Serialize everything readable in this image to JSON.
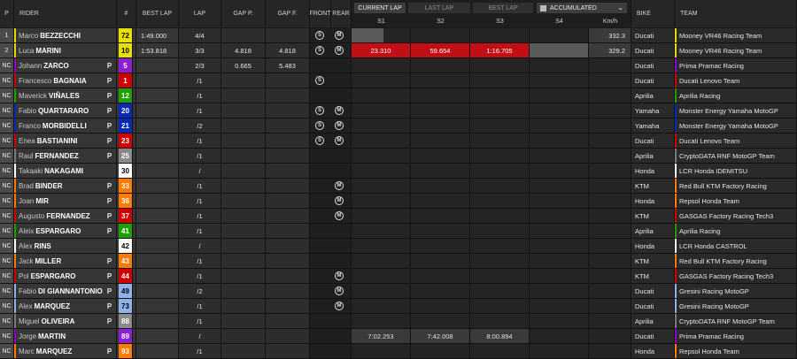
{
  "header": {
    "pos": "P",
    "rider": "RIDER",
    "num": "#",
    "best_lap": "BEST LAP",
    "lap": "LAP",
    "gap_p": "GAP P.",
    "gap_f": "GAP F.",
    "front": "FRONT",
    "rear": "REAR",
    "bike": "BIKE",
    "team": "TEAM",
    "kmh": "Km/h",
    "s1": "S1",
    "s2": "S2",
    "s3": "S3",
    "s4": "S4"
  },
  "modes": {
    "current": "CURRENT LAP",
    "last": "LAST LAP",
    "best": "BEST LAP",
    "selected": "ACCUMULATED"
  },
  "colors": {
    "ducati_team": "#e3d800",
    "pramac": "#8c00c8",
    "lenovo": "#d40000",
    "aprilia": "#1ea000",
    "yamaha": "#0a2ab4",
    "honda": "#ffffff",
    "ktm": "#ff7a00",
    "gresini": "#8fb3e8",
    "gasgas": "#d40000",
    "sector_red": "#c20f16"
  },
  "riders": [
    {
      "pos": "1",
      "first": "Marco",
      "last": "BEZZECCHI",
      "pit": "",
      "num": "72",
      "numbg": "#e8e000",
      "numfg": "#000",
      "best": "1:49.000",
      "lap": "4/4",
      "gapp": "",
      "gapf": "",
      "front": "S",
      "rear": "M",
      "s1": "",
      "s2": "",
      "s3": "",
      "s4": "",
      "kmh": "332.3",
      "bike": "Ducati",
      "team": "Mooney VR46 Racing Team",
      "accent": "#e3d800",
      "s1type": "partial",
      "kmhbar": true
    },
    {
      "pos": "2",
      "first": "Luca",
      "last": "MARINI",
      "pit": "",
      "num": "10",
      "numbg": "#e8e000",
      "numfg": "#000",
      "best": "1:53.818",
      "lap": "3/3",
      "gapp": "4.818",
      "gapf": "4.818",
      "front": "S",
      "rear": "M",
      "s1": "23.310",
      "s2": "59.654",
      "s3": "1:16.705",
      "s4": "",
      "kmh": "329.2",
      "bike": "Ducati",
      "team": "Mooney VR46 Racing Team",
      "accent": "#e3d800",
      "s1type": "red",
      "s2type": "red",
      "s3type": "red",
      "s4type": "gray",
      "kmhbar": true
    },
    {
      "pos": "NC",
      "first": "Johann",
      "last": "ZARCO",
      "pit": "P",
      "num": "5",
      "numbg": "#8c1fd0",
      "numfg": "#fff",
      "best": "",
      "lap": "2/3",
      "gapp": "0.665",
      "gapf": "5.483",
      "front": "",
      "rear": "",
      "s1": "",
      "s2": "",
      "s3": "",
      "s4": "",
      "kmh": "",
      "bike": "Ducati",
      "team": "Prima Pramac Racing",
      "accent": "#8c00c8"
    },
    {
      "pos": "NC",
      "first": "Francesco",
      "last": "BAGNAIA",
      "pit": "P",
      "num": "1",
      "numbg": "#d00000",
      "numfg": "#fff",
      "best": "",
      "lap": "/1",
      "gapp": "",
      "gapf": "",
      "front": "S",
      "rear": "",
      "s1": "",
      "s2": "",
      "s3": "",
      "s4": "",
      "kmh": "",
      "bike": "Ducati",
      "team": "Ducati Lenovo Team",
      "accent": "#d40000"
    },
    {
      "pos": "NC",
      "first": "Maverick",
      "last": "VIÑALES",
      "pit": "P",
      "num": "12",
      "numbg": "#1ea000",
      "numfg": "#fff",
      "best": "",
      "lap": "/1",
      "gapp": "",
      "gapf": "",
      "front": "",
      "rear": "",
      "s1": "",
      "s2": "",
      "s3": "",
      "s4": "",
      "kmh": "",
      "bike": "Aprilia",
      "team": "Aprilia Racing",
      "accent": "#1ea000"
    },
    {
      "pos": "NC",
      "first": "Fabio",
      "last": "QUARTARARO",
      "pit": "P",
      "num": "20",
      "numbg": "#0a2ab4",
      "numfg": "#fff",
      "best": "",
      "lap": "/1",
      "gapp": "",
      "gapf": "",
      "front": "S",
      "rear": "M",
      "s1": "",
      "s2": "",
      "s3": "",
      "s4": "",
      "kmh": "",
      "bike": "Yamaha",
      "team": "Monster Energy Yamaha MotoGP",
      "accent": "#0a2ab4"
    },
    {
      "pos": "NC",
      "first": "Franco",
      "last": "MORBIDELLI",
      "pit": "P",
      "num": "21",
      "numbg": "#0a2ab4",
      "numfg": "#fff",
      "best": "",
      "lap": "/2",
      "gapp": "",
      "gapf": "",
      "front": "S",
      "rear": "M",
      "s1": "",
      "s2": "",
      "s3": "",
      "s4": "",
      "kmh": "",
      "bike": "Yamaha",
      "team": "Monster Energy Yamaha MotoGP",
      "accent": "#0a2ab4"
    },
    {
      "pos": "NC",
      "first": "Enea",
      "last": "BASTIANINI",
      "pit": "P",
      "num": "23",
      "numbg": "#d00000",
      "numfg": "#fff",
      "best": "",
      "lap": "/1",
      "gapp": "",
      "gapf": "",
      "front": "S",
      "rear": "M",
      "s1": "",
      "s2": "",
      "s3": "",
      "s4": "",
      "kmh": "",
      "bike": "Ducati",
      "team": "Ducati Lenovo Team",
      "accent": "#d40000"
    },
    {
      "pos": "NC",
      "first": "Raul",
      "last": "FERNANDEZ",
      "pit": "P",
      "num": "25",
      "numbg": "#8a8a8a",
      "numfg": "#fff",
      "best": "",
      "lap": "/1",
      "gapp": "",
      "gapf": "",
      "front": "",
      "rear": "",
      "s1": "",
      "s2": "",
      "s3": "",
      "s4": "",
      "kmh": "",
      "bike": "Aprilia",
      "team": "CryptoDATA RNF MotoGP Team",
      "accent": "#7a7a7a"
    },
    {
      "pos": "NC",
      "first": "Takaaki",
      "last": "NAKAGAMI",
      "pit": "",
      "num": "30",
      "numbg": "#ffffff",
      "numfg": "#000",
      "best": "",
      "lap": "/",
      "gapp": "",
      "gapf": "",
      "front": "",
      "rear": "",
      "s1": "",
      "s2": "",
      "s3": "",
      "s4": "",
      "kmh": "",
      "bike": "Honda",
      "team": "LCR Honda IDEMITSU",
      "accent": "#ffffff"
    },
    {
      "pos": "NC",
      "first": "Brad",
      "last": "BINDER",
      "pit": "P",
      "num": "33",
      "numbg": "#ff7a00",
      "numfg": "#fff",
      "best": "",
      "lap": "/1",
      "gapp": "",
      "gapf": "",
      "front": "",
      "rear": "M",
      "s1": "",
      "s2": "",
      "s3": "",
      "s4": "",
      "kmh": "",
      "bike": "KTM",
      "team": "Red Bull KTM Factory Racing",
      "accent": "#ff7a00"
    },
    {
      "pos": "NC",
      "first": "Joan",
      "last": "MIR",
      "pit": "P",
      "num": "36",
      "numbg": "#ff7a00",
      "numfg": "#fff",
      "best": "",
      "lap": "/1",
      "gapp": "",
      "gapf": "",
      "front": "",
      "rear": "M",
      "s1": "",
      "s2": "",
      "s3": "",
      "s4": "",
      "kmh": "",
      "bike": "Honda",
      "team": "Repsol Honda Team",
      "accent": "#ff7a00"
    },
    {
      "pos": "NC",
      "first": "Augusto",
      "last": "FERNANDEZ",
      "pit": "P",
      "num": "37",
      "numbg": "#d00000",
      "numfg": "#fff",
      "best": "",
      "lap": "/1",
      "gapp": "",
      "gapf": "",
      "front": "",
      "rear": "M",
      "s1": "",
      "s2": "",
      "s3": "",
      "s4": "",
      "kmh": "",
      "bike": "KTM",
      "team": "GASGAS Factory Racing Tech3",
      "accent": "#d40000"
    },
    {
      "pos": "NC",
      "first": "Aleix",
      "last": "ESPARGARO",
      "pit": "P",
      "num": "41",
      "numbg": "#1ea000",
      "numfg": "#fff",
      "best": "",
      "lap": "/1",
      "gapp": "",
      "gapf": "",
      "front": "",
      "rear": "",
      "s1": "",
      "s2": "",
      "s3": "",
      "s4": "",
      "kmh": "",
      "bike": "Aprilia",
      "team": "Aprilia Racing",
      "accent": "#1ea000"
    },
    {
      "pos": "NC",
      "first": "Alex",
      "last": "RINS",
      "pit": "",
      "num": "42",
      "numbg": "#ffffff",
      "numfg": "#000",
      "best": "",
      "lap": "/",
      "gapp": "",
      "gapf": "",
      "front": "",
      "rear": "",
      "s1": "",
      "s2": "",
      "s3": "",
      "s4": "",
      "kmh": "",
      "bike": "Honda",
      "team": "LCR Honda CASTROL",
      "accent": "#ffffff"
    },
    {
      "pos": "NC",
      "first": "Jack",
      "last": "MILLER",
      "pit": "P",
      "num": "43",
      "numbg": "#ff7a00",
      "numfg": "#fff",
      "best": "",
      "lap": "/1",
      "gapp": "",
      "gapf": "",
      "front": "",
      "rear": "",
      "s1": "",
      "s2": "",
      "s3": "",
      "s4": "",
      "kmh": "",
      "bike": "KTM",
      "team": "Red Bull KTM Factory Racing",
      "accent": "#ff7a00"
    },
    {
      "pos": "NC",
      "first": "Pol",
      "last": "ESPARGARO",
      "pit": "P",
      "num": "44",
      "numbg": "#d00000",
      "numfg": "#fff",
      "best": "",
      "lap": "/1",
      "gapp": "",
      "gapf": "",
      "front": "",
      "rear": "M",
      "s1": "",
      "s2": "",
      "s3": "",
      "s4": "",
      "kmh": "",
      "bike": "KTM",
      "team": "GASGAS Factory Racing Tech3",
      "accent": "#d40000"
    },
    {
      "pos": "NC",
      "first": "Fabio",
      "last": "DI GIANNANTONIO",
      "pit": "P",
      "num": "49",
      "numbg": "#8fb3e8",
      "numfg": "#000",
      "best": "",
      "lap": "/2",
      "gapp": "",
      "gapf": "",
      "front": "",
      "rear": "M",
      "s1": "",
      "s2": "",
      "s3": "",
      "s4": "",
      "kmh": "",
      "bike": "Ducati",
      "team": "Gresini Racing MotoGP",
      "accent": "#8fb3e8"
    },
    {
      "pos": "NC",
      "first": "Alex",
      "last": "MARQUEZ",
      "pit": "P",
      "num": "73",
      "numbg": "#8fb3e8",
      "numfg": "#000",
      "best": "",
      "lap": "/1",
      "gapp": "",
      "gapf": "",
      "front": "",
      "rear": "M",
      "s1": "",
      "s2": "",
      "s3": "",
      "s4": "",
      "kmh": "",
      "bike": "Ducati",
      "team": "Gresini Racing MotoGP",
      "accent": "#8fb3e8"
    },
    {
      "pos": "NC",
      "first": "Miguel",
      "last": "OLIVEIRA",
      "pit": "P",
      "num": "88",
      "numbg": "#8a8a8a",
      "numfg": "#fff",
      "best": "",
      "lap": "/1",
      "gapp": "",
      "gapf": "",
      "front": "",
      "rear": "",
      "s1": "",
      "s2": "",
      "s3": "",
      "s4": "",
      "kmh": "",
      "bike": "Aprilia",
      "team": "CryptoDATA RNF MotoGP Team",
      "accent": "#7a7a7a"
    },
    {
      "pos": "NC",
      "first": "Jorge",
      "last": "MARTIN",
      "pit": "",
      "num": "89",
      "numbg": "#8c1fd0",
      "numfg": "#fff",
      "best": "",
      "lap": "/",
      "gapp": "",
      "gapf": "",
      "front": "",
      "rear": "",
      "s1": "7:02.253",
      "s2": "7:42.008",
      "s3": "8:00.894",
      "s4": "",
      "kmh": "",
      "bike": "Ducati",
      "team": "Prima Pramac Racing",
      "accent": "#8c00c8",
      "s1type": "time",
      "s2type": "time",
      "s3type": "time"
    },
    {
      "pos": "NC",
      "first": "Marc",
      "last": "MARQUEZ",
      "pit": "P",
      "num": "93",
      "numbg": "#ff7a00",
      "numfg": "#fff",
      "best": "",
      "lap": "/1",
      "gapp": "",
      "gapf": "",
      "front": "",
      "rear": "",
      "s1": "",
      "s2": "",
      "s3": "",
      "s4": "",
      "kmh": "",
      "bike": "Honda",
      "team": "Repsol Honda Team",
      "accent": "#ff7a00"
    }
  ]
}
